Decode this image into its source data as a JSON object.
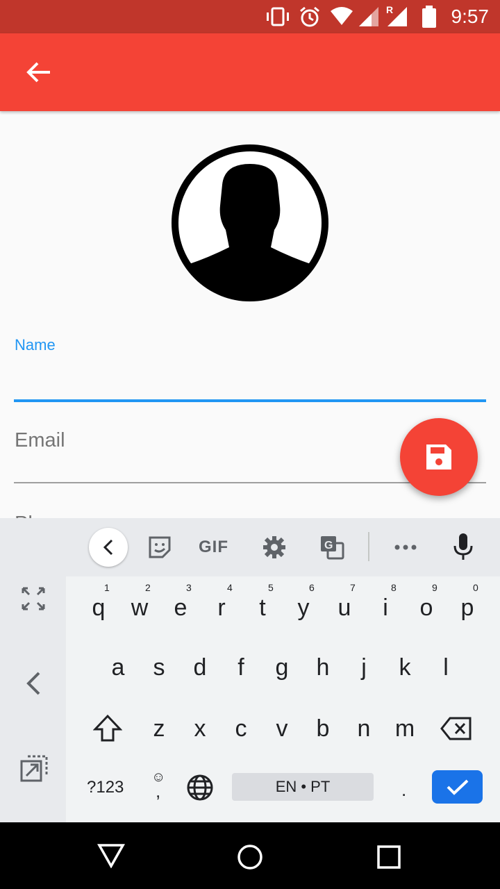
{
  "status_bar": {
    "time": "9:57",
    "roaming_label": "R"
  },
  "form": {
    "name_label": "Name",
    "email_label": "Email",
    "phone_label": "Phone"
  },
  "keyboard": {
    "row1": [
      "q",
      "w",
      "e",
      "r",
      "t",
      "y",
      "u",
      "i",
      "o",
      "p"
    ],
    "row1_hints": [
      "1",
      "2",
      "3",
      "4",
      "5",
      "6",
      "7",
      "8",
      "9",
      "0"
    ],
    "row2": [
      "a",
      "s",
      "d",
      "f",
      "g",
      "h",
      "j",
      "k",
      "l"
    ],
    "row3": [
      "z",
      "x",
      "c",
      "v",
      "b",
      "n",
      "m"
    ],
    "symbols_label": "?123",
    "comma": ",",
    "period": ".",
    "space_label": "EN • PT",
    "gif_label": "GIF"
  },
  "colors": {
    "status_bar": "#c0362b",
    "app_bar": "#f44336",
    "accent": "#2196f3",
    "enter_key": "#1a73e8"
  }
}
